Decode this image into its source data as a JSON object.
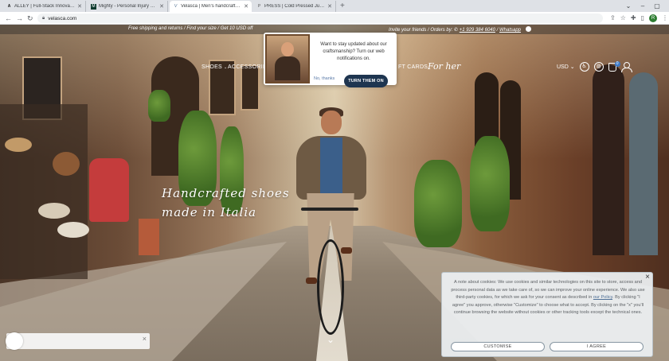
{
  "browser": {
    "tabs": [
      {
        "title": "ALLEY | Full-Stack Innovation Ap",
        "favicon": "A",
        "active": false
      },
      {
        "title": "Mighty - Personal Injury Lien Mo",
        "favicon": "M",
        "active": false
      },
      {
        "title": "Velasca | Men's handcrafted shoe",
        "favicon": "V",
        "active": true
      },
      {
        "title": "PRESS | Cold Pressed Juice Clea",
        "favicon": "P",
        "active": false
      }
    ],
    "url": "velasca.com",
    "profile_initial": "R"
  },
  "promo": {
    "left_text": "Free shipping and returns / Find your size / Get 10 USD off",
    "right_prefix": "Invite your friends / Orders by:",
    "phone": "+1 929 384 6040",
    "whatsapp": "Whatsapp"
  },
  "nav": {
    "shoes": "SHOES",
    "accessories": "ACCESSORIES",
    "gift_cards": "FT CARDS",
    "for_her": "For her",
    "currency": "USD",
    "cart_count": "0"
  },
  "hero": {
    "line1": "Handcrafted shoes",
    "line2": "made in Italia"
  },
  "push_prompt": {
    "message": "Want to stay updated about our craftsmanship? Turn our web notifications on.",
    "decline": "No, thanks",
    "accept": "TURN THEM ON"
  },
  "cookie": {
    "text_before_link": "A note about cookies: We use cookies and similar technologies on this site to store, access and process personal data as we take care of, so we can improve your online experience. We also use third-party cookies, for which we ask for your consent as described in",
    "link": "our Policy",
    "text_after_link": ". By clicking \"I agree\" you approve, otherwise \"Customize\" to choose what to accept. By clicking on the \"x\" you'll continue browsing the website without cookies or other tracking tools except the technical ones.",
    "customise": "CUSTOMISE",
    "agree": "I AGREE"
  },
  "colors": {
    "push_button": "#1e3550",
    "cart_badge": "#3d7ac8",
    "cookie_link": "#4e6f96"
  }
}
